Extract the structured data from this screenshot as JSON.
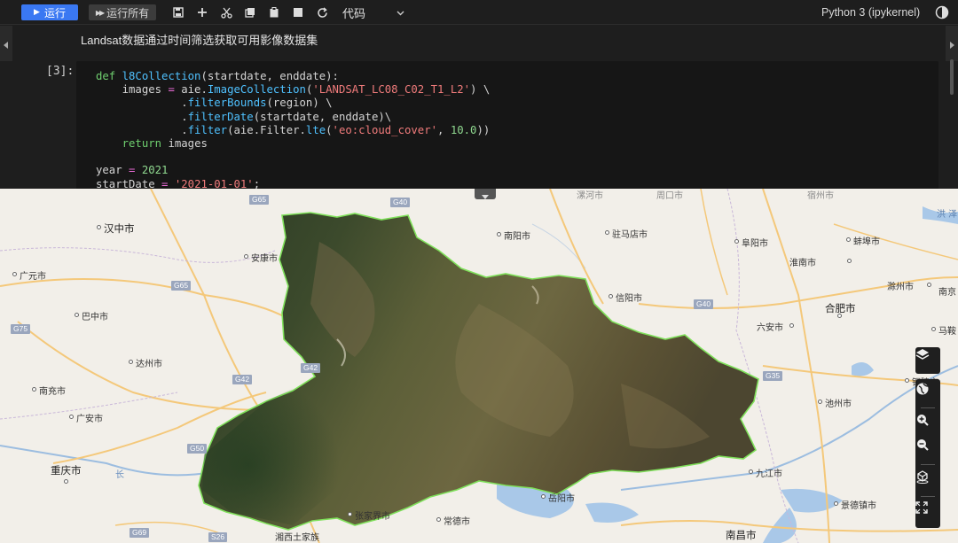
{
  "toolbar": {
    "run_label": "运行",
    "run_all_label": "运行所有",
    "cell_type": "代码",
    "kernel_name": "Python 3 (ipykernel)"
  },
  "notebook": {
    "markdown_text": "Landsat数据通过时间筛选获取可用影像数据集",
    "prompt": "[3]:",
    "code_lines": [
      "def l8Collection(startdate, enddate):",
      "    images = aie.ImageCollection('LANDSAT_LC08_C02_T1_L2') \\",
      "             .filterBounds(region) \\",
      "             .filterDate(startdate, enddate)\\",
      "             .filter(aie.Filter.lte('eo:cloud_cover', 10.0))",
      "    return images",
      "",
      "year = 2021",
      "startDate = '2021-01-01';"
    ]
  },
  "map": {
    "cities": {
      "hanzhong": "汉中市",
      "ankang": "安康市",
      "guangyuan": "广元市",
      "bazhong": "巴中市",
      "dazhou": "达州市",
      "nanchong": "南充市",
      "guangan": "广安市",
      "chongqing": "重庆市",
      "nanyang": "南阳市",
      "zhumadian": "驻马店市",
      "fuyang": "阜阳市",
      "bengbu": "蚌埠市",
      "huainan": "淮南市",
      "chuzhou": "滁州市",
      "xinyang": "信阳市",
      "hefei": "合肥市",
      "luan": "六安市",
      "nanjing": "南京",
      "maanshan": "马鞍",
      "tongling": "铜陵市",
      "chizhou": "池州市",
      "jiujiang": "九江市",
      "jingdezhen": "景德镇市",
      "yueyang": "岳阳市",
      "changde": "常德市",
      "zhangjiajie": "张家界市",
      "xiangxi": "湘西土家族",
      "nanchang": "南昌市",
      "luohe": "漯河市",
      "zhoukou": "周口市",
      "suzhou": "宿州市",
      "hongze": "洪 泽",
      "changjiang": "长"
    },
    "highways": [
      "G65",
      "G40",
      "G65",
      "G75",
      "G42",
      "G42",
      "G40",
      "G35",
      "G50",
      "G69",
      "S26"
    ],
    "controls": [
      "layers-icon",
      "globe-icon",
      "zoom-in-icon",
      "zoom-out-icon",
      "3d-view-icon",
      "fullscreen-icon"
    ]
  }
}
